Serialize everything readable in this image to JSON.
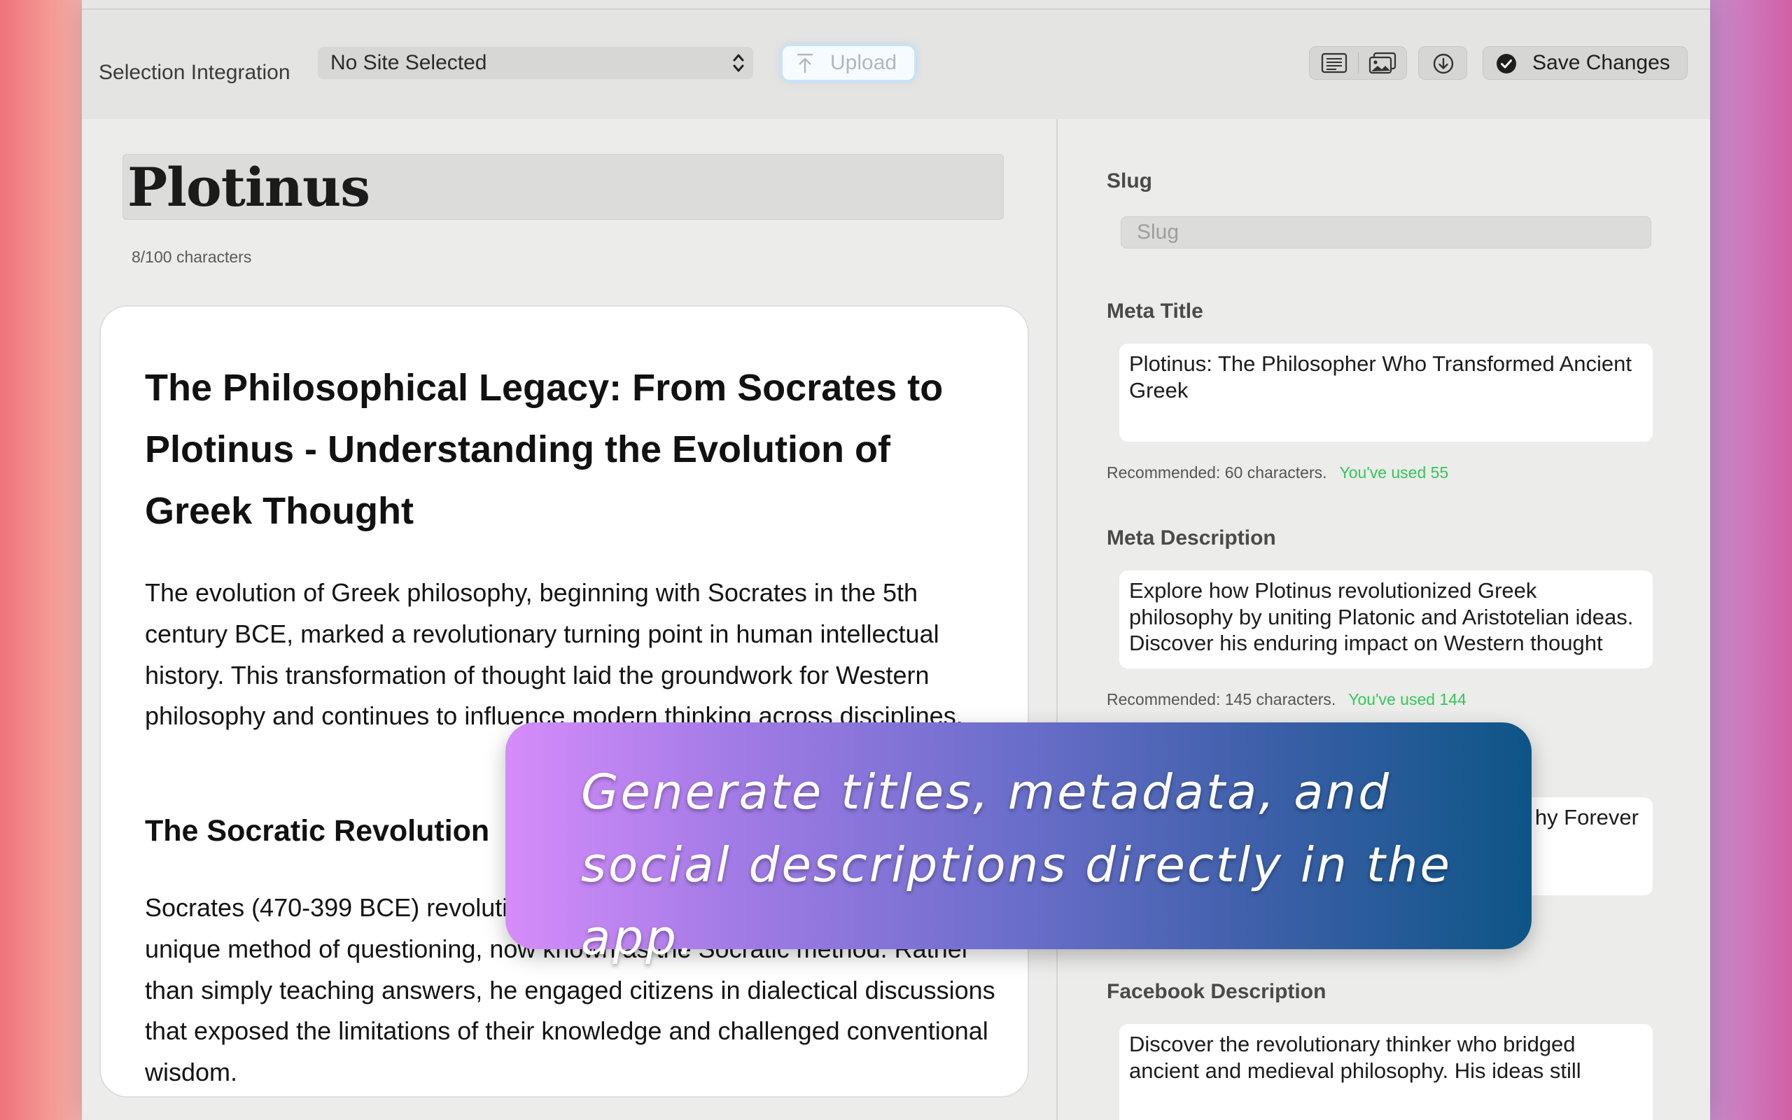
{
  "toolbar": {
    "integration_label": "Selection Integration",
    "site_select_value": "No Site Selected",
    "upload_label": "Upload",
    "save_label": "Save Changes"
  },
  "post": {
    "title": "Plotinus",
    "title_char_count": "8/100 characters"
  },
  "editor": {
    "heading": "The Philosophical Legacy: From Socrates to Plotinus - Understanding the Evolution of Greek Thought",
    "paragraph1": "The evolution of Greek philosophy, beginning with Socrates in the 5th century BCE, marked a revolutionary turning point in human intellectual history. This transformation of thought laid the groundwork for Western philosophy and continues to influence modern thinking across disciplines.",
    "subheading": "The Socratic Revolution",
    "paragraph2": "Socrates (470-399 BCE) revolutionized philosophical inquiry through his unique method of questioning, now known as the Socratic method. Rather than simply teaching answers, he engaged citizens in dialectical discussions that exposed the limitations of their knowledge and challenged conventional wisdom."
  },
  "seo": {
    "slug_label": "Slug",
    "slug_placeholder": "Slug",
    "meta_title_label": "Meta Title",
    "meta_title_value": "Plotinus: The Philosopher Who Transformed Ancient Greek",
    "meta_title_recommended": "Recommended: 60 characters.",
    "meta_title_used": "You've used 55",
    "meta_description_label": "Meta Description",
    "meta_description_value": "Explore how Plotinus revolutionized Greek philosophy by uniting Platonic and Aristotelian ideas. Discover his enduring impact on Western thought",
    "meta_description_recommended": "Recommended: 145 characters.",
    "meta_description_used": "You've used 144",
    "hidden_box_visible_text": "hy Forever",
    "facebook_description_label": "Facebook Description",
    "facebook_description_value": "Discover the revolutionary thinker who bridged ancient and medieval philosophy. His ideas still"
  },
  "overlay": {
    "caption": "Generate titles, metadata, and social descriptions directly in the app."
  },
  "colors": {
    "used_count": "#34c759",
    "overlay_gradient_start": "#d58cfa",
    "overlay_gradient_end": "#0d5586"
  },
  "icons": [
    "chevron-updown-icon",
    "upload-arrow-icon",
    "text-view-icon",
    "image-view-icon",
    "download-icon",
    "checkmark-circle-icon"
  ]
}
